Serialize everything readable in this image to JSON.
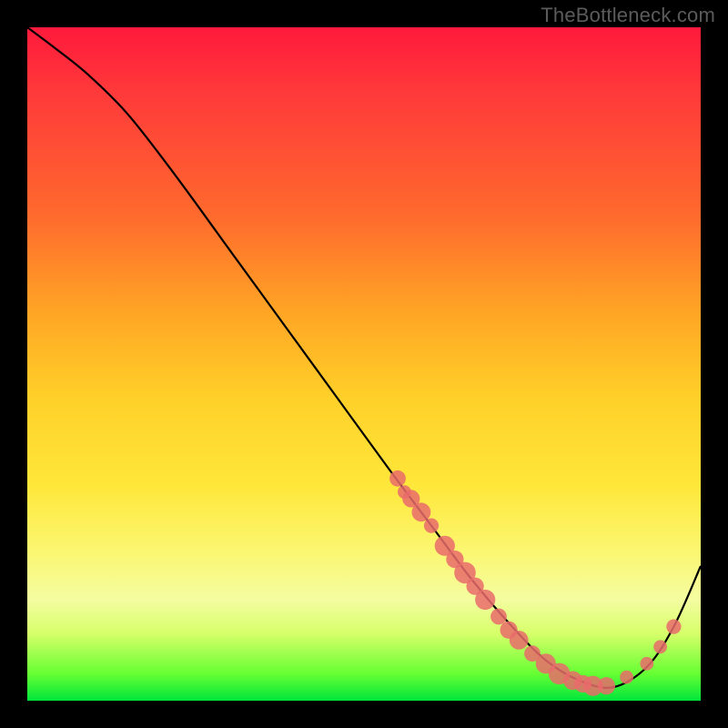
{
  "watermark": "TheBottleneck.com",
  "chart_data": {
    "type": "line",
    "title": "",
    "xlabel": "",
    "ylabel": "",
    "xlim": [
      0,
      100
    ],
    "ylim": [
      0,
      100
    ],
    "series": [
      {
        "name": "curve",
        "x": [
          0,
          4,
          9,
          15,
          22,
          30,
          38,
          46,
          54,
          60,
          66,
          72,
          77,
          82,
          87,
          92,
          96,
          100
        ],
        "y": [
          100,
          97,
          93,
          87,
          78,
          67,
          56,
          45,
          34,
          26,
          18,
          11,
          6,
          3,
          2,
          5,
          11,
          20
        ]
      }
    ],
    "markers": [
      {
        "x": 55,
        "y": 33,
        "r": 1.2
      },
      {
        "x": 56,
        "y": 31,
        "r": 1.0
      },
      {
        "x": 57,
        "y": 30,
        "r": 1.3
      },
      {
        "x": 58.5,
        "y": 28,
        "r": 1.4
      },
      {
        "x": 60,
        "y": 26,
        "r": 1.1
      },
      {
        "x": 62,
        "y": 23,
        "r": 1.5
      },
      {
        "x": 63.5,
        "y": 21,
        "r": 1.3
      },
      {
        "x": 65,
        "y": 19,
        "r": 1.6
      },
      {
        "x": 66.5,
        "y": 17,
        "r": 1.3
      },
      {
        "x": 68,
        "y": 15,
        "r": 1.5
      },
      {
        "x": 70,
        "y": 12.5,
        "r": 1.2
      },
      {
        "x": 71.5,
        "y": 10.5,
        "r": 1.3
      },
      {
        "x": 73,
        "y": 9,
        "r": 1.4
      },
      {
        "x": 75,
        "y": 7,
        "r": 1.2
      },
      {
        "x": 77,
        "y": 5.5,
        "r": 1.5
      },
      {
        "x": 79,
        "y": 4,
        "r": 1.6
      },
      {
        "x": 81,
        "y": 3,
        "r": 1.4
      },
      {
        "x": 82.5,
        "y": 2.5,
        "r": 1.3
      },
      {
        "x": 84,
        "y": 2.2,
        "r": 1.5
      },
      {
        "x": 86,
        "y": 2.2,
        "r": 1.3
      },
      {
        "x": 89,
        "y": 3.5,
        "r": 1.0
      },
      {
        "x": 92,
        "y": 5.5,
        "r": 1.0
      },
      {
        "x": 94,
        "y": 8,
        "r": 1.0
      },
      {
        "x": 96,
        "y": 11,
        "r": 1.1
      }
    ],
    "colors": {
      "curve": "#000000",
      "marker": "#e96b6b",
      "background_top": "#ff1a3c",
      "background_bottom": "#00e63b"
    }
  }
}
